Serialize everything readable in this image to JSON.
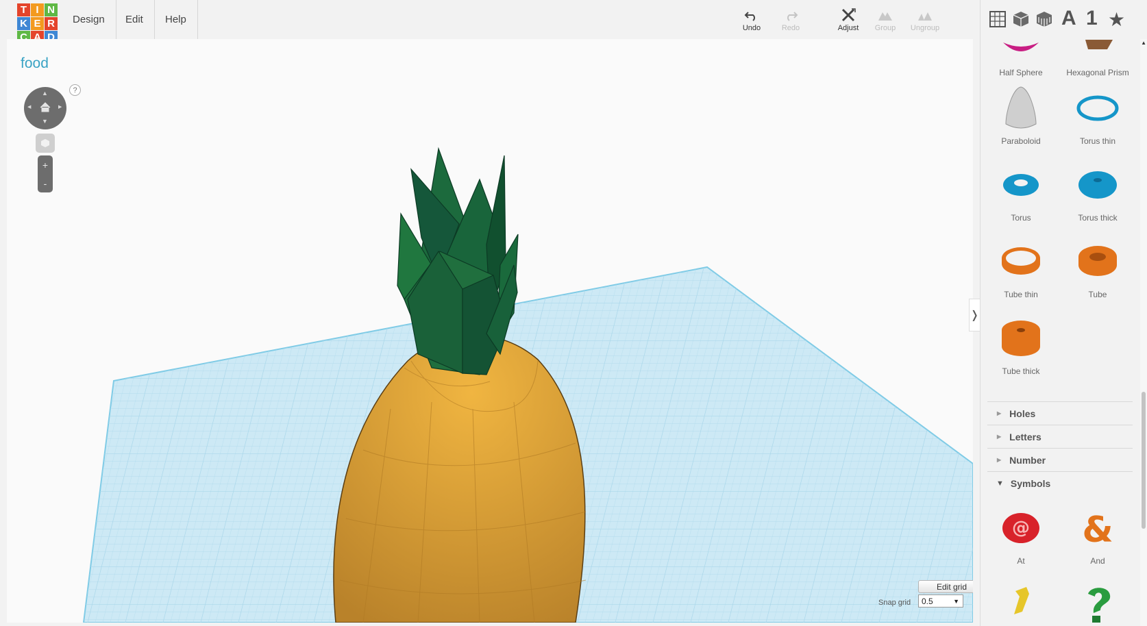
{
  "app": {
    "logo_letters": [
      "T",
      "I",
      "N",
      "K",
      "E",
      "R",
      "C",
      "A",
      "D"
    ],
    "logo_colors": [
      "#e4442b",
      "#f39a1f",
      "#5fb845",
      "#3f87d4",
      "#f39a1f",
      "#e4442b",
      "#5fb845",
      "#e4442b",
      "#3f87d4"
    ],
    "accent_color": "#3aa3c4"
  },
  "menu": [
    {
      "label": "Design"
    },
    {
      "label": "Edit"
    },
    {
      "label": "Help"
    }
  ],
  "toolbar": {
    "undo": "Undo",
    "redo": "Redo",
    "adjust": "Adjust",
    "group": "Group",
    "ungroup": "Ungroup"
  },
  "panel_icons": {
    "letter": "A",
    "number": "1",
    "star": "★"
  },
  "workplane": {
    "title": "food",
    "help": "?",
    "zoom_in": "+",
    "zoom_out": "-",
    "edit_grid": "Edit grid",
    "snap_label": "Snap grid",
    "snap_value": "0.5",
    "plane_color": "#cde9f5",
    "grid_color": "#a9d7ea",
    "object_body_color": "#e0a436",
    "object_leaf_color": "#1e6b3e"
  },
  "shapes": [
    {
      "label": "Half Sphere",
      "icon": "half-sphere-icon",
      "color": "#c81e83"
    },
    {
      "label": "Hexagonal Prism",
      "icon": "hexagonal-prism-icon",
      "color": "#8a5a36"
    },
    {
      "label": "Paraboloid",
      "icon": "paraboloid-icon",
      "color": "#cfcfcf"
    },
    {
      "label": "Torus thin",
      "icon": "torus-thin-icon",
      "color": "#1596c9"
    },
    {
      "label": "Torus",
      "icon": "torus-icon",
      "color": "#1596c9"
    },
    {
      "label": "Torus thick",
      "icon": "torus-thick-icon",
      "color": "#1596c9"
    },
    {
      "label": "Tube thin",
      "icon": "tube-thin-icon",
      "color": "#e2731b"
    },
    {
      "label": "Tube",
      "icon": "tube-icon",
      "color": "#e2731b"
    },
    {
      "label": "Tube thick",
      "icon": "tube-thick-icon",
      "color": "#e2731b"
    }
  ],
  "categories": [
    {
      "label": "Holes"
    },
    {
      "label": "Letters"
    },
    {
      "label": "Number"
    },
    {
      "label": "Symbols"
    }
  ],
  "symbols": [
    {
      "label": "At",
      "icon": "at-symbol-icon",
      "color": "#d8222a"
    },
    {
      "label": "And",
      "icon": "ampersand-symbol-icon",
      "color": "#e2731b"
    },
    {
      "label": "",
      "icon": "exclamation-symbol-icon",
      "color": "#e6c62a"
    },
    {
      "label": "",
      "icon": "question-symbol-icon",
      "color": "#2a9c3f"
    }
  ]
}
